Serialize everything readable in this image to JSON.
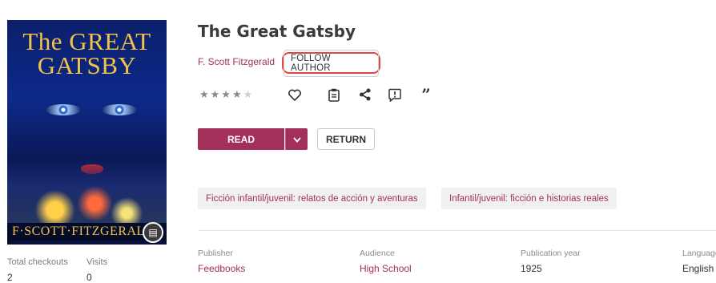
{
  "book": {
    "title": "The Great Gatsby",
    "author": "F. Scott Fitzgerald",
    "follow_label": "FOLLOW AUTHOR",
    "cover": {
      "title_line1": "The GREAT",
      "title_line2": "GATSBY",
      "author": "F·SCOTT·FITZGERALD"
    },
    "rating": {
      "value": 3.5,
      "max": 5,
      "stars_text": "★★★★",
      "dim_text": "★"
    }
  },
  "actions": {
    "icons": [
      "heart-icon",
      "clipboard-icon",
      "share-icon",
      "report-icon",
      "quote-icon"
    ]
  },
  "buttons": {
    "read": "READ",
    "return": "RETURN"
  },
  "tags": [
    "Ficción infantil/juvenil: relatos de acción y aventuras",
    "Infantil/juvenil: ficción e historias reales"
  ],
  "stats": {
    "total_checkouts_label": "Total checkouts",
    "total_checkouts": "2",
    "visits_label": "Visits",
    "visits": "0"
  },
  "meta": {
    "publisher_label": "Publisher",
    "publisher": "Feedbooks",
    "audience_label": "Audience",
    "audience": "High School",
    "year_label": "Publication year",
    "year": "1925",
    "language_label": "Language",
    "language": "English"
  },
  "colors": {
    "accent": "#a3305a",
    "highlight": "#e24646"
  }
}
